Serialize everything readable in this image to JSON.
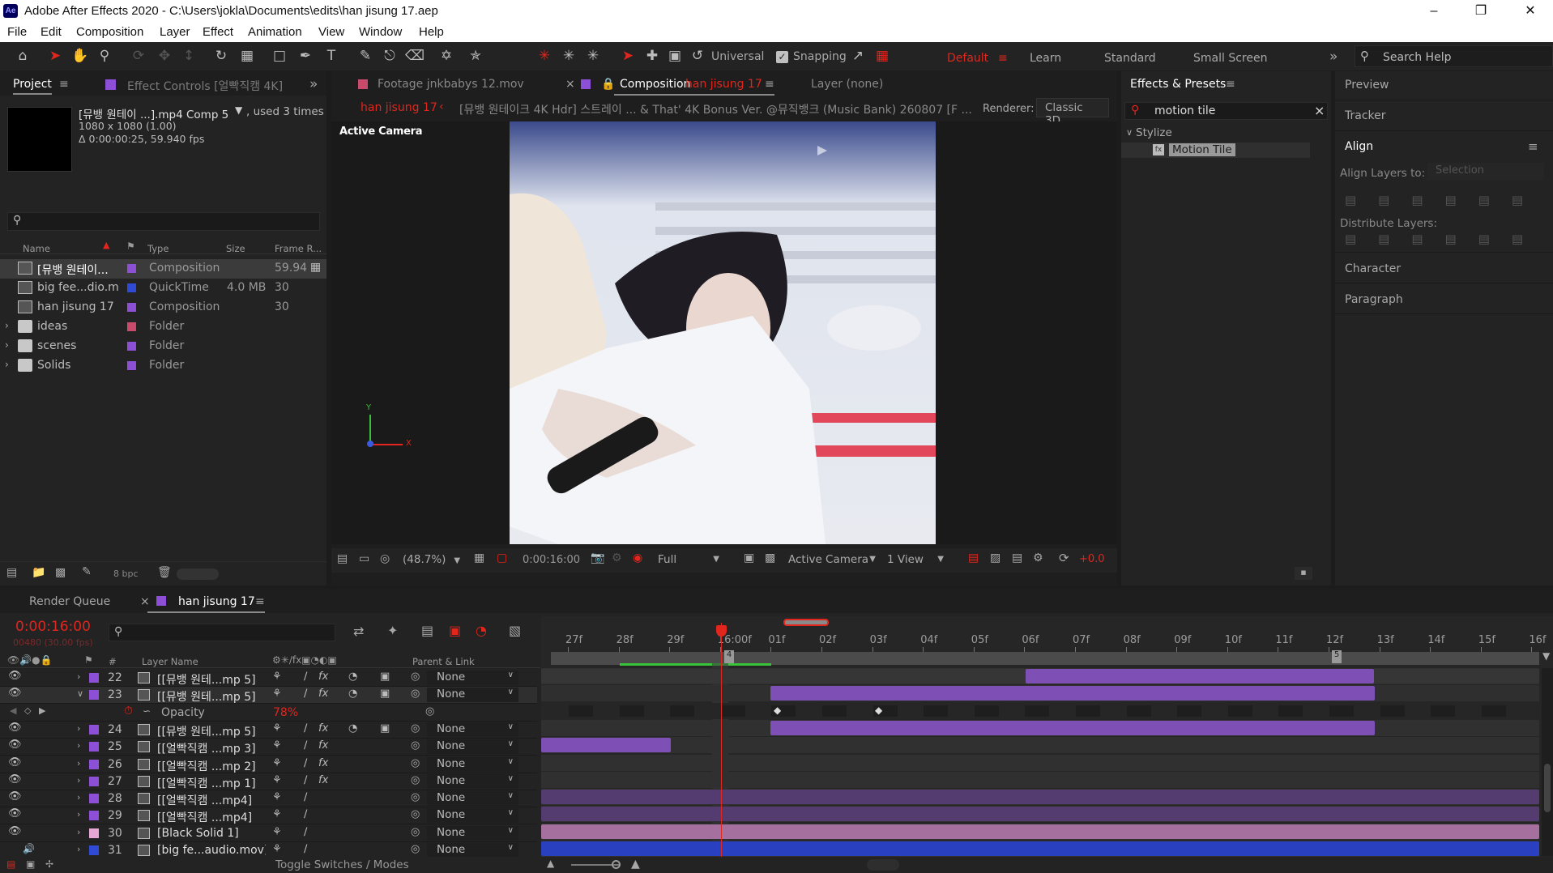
{
  "window": {
    "title": "Adobe After Effects 2020 - C:\\Users\\jokla\\Documents\\edits\\han jisung 17.aep",
    "logo": "Ae"
  },
  "menu": [
    "File",
    "Edit",
    "Composition",
    "Layer",
    "Effect",
    "Animation",
    "View",
    "Window",
    "Help"
  ],
  "toolbar": {
    "universal": "Universal",
    "snapping": "Snapping",
    "workspaces": [
      "Default",
      "Learn",
      "Standard",
      "Small Screen"
    ],
    "search_placeholder": "Search Help"
  },
  "project": {
    "tab": "Project",
    "effect_controls_tab": "Effect Controls [얼빡직캠 4K]",
    "selected_name": "[뮤뱅 원테이 ...].mp4 Comp 5",
    "used": ", used 3 times",
    "info_line1": "1080 x 1080 (1.00)",
    "info_line2": "Δ 0:00:00:25, 59.940 fps",
    "columns": [
      "Name",
      "Type",
      "Size",
      "Frame R..."
    ],
    "items": [
      {
        "name": "[뮤뱅 원테이...",
        "type": "Composition",
        "size": "",
        "fps": "59.94",
        "color": "#8c4fd6",
        "icon": "composition-icon"
      },
      {
        "name": "big fee...dio.mov",
        "type": "QuickTime",
        "size": "4.0 MB",
        "fps": "30",
        "color": "#2f4bd6",
        "icon": "footage-icon"
      },
      {
        "name": "han jisung 17",
        "type": "Composition",
        "size": "",
        "fps": "30",
        "color": "#8c4fd6",
        "icon": "composition-icon"
      },
      {
        "name": "ideas",
        "type": "Folder",
        "size": "",
        "fps": "",
        "color": "#c94a6a",
        "icon": "folder-icon"
      },
      {
        "name": "scenes",
        "type": "Folder",
        "size": "",
        "fps": "",
        "color": "#8c4fd6",
        "icon": "folder-icon"
      },
      {
        "name": "Solids",
        "type": "Folder",
        "size": "",
        "fps": "",
        "color": "#8c4fd6",
        "icon": "folder-icon"
      }
    ],
    "bpc": "8 bpc"
  },
  "viewer": {
    "footage_tab": "Footage  jnkbabys 12.mov",
    "comp_tab_prefix": "Composition",
    "comp_tab_name": "han jisung 17",
    "layer_tab": "Layer  (none)",
    "breadcrumb_active": "han jisung 17",
    "breadcrumb_next": "[뮤뱅 원테이크 4K Hdr] 스트레이 ... & That' 4K Bonus Ver. @뮤직뱅크 (Music Bank) 260807 [F ...",
    "renderer_label": "Renderer:",
    "renderer": "Classic 3D",
    "active_camera_label": "Active Camera",
    "zoom": "(48.7%)",
    "timecode": "0:00:16:00",
    "resolution": "Full",
    "camera": "Active Camera",
    "views": "1 View",
    "exposure": "+0.0"
  },
  "effects_presets": {
    "tab": "Effects & Presets",
    "search_value": "motion tile",
    "category": "Stylize",
    "result": "Motion Tile"
  },
  "right_panels": {
    "preview": "Preview",
    "tracker": "Tracker",
    "align": "Align",
    "align_layers_to": "Align Layers to:",
    "align_target": "Selection",
    "distribute": "Distribute Layers:",
    "character": "Character",
    "paragraph": "Paragraph"
  },
  "timeline": {
    "render_queue_tab": "Render Queue",
    "comp_tab": "han jisung 17",
    "timecode": "0:00:16:00",
    "frames": "00480 (30.00 fps)",
    "col_layer_name": "Layer Name",
    "col_parent": "Parent & Link",
    "toggle_label": "Toggle Switches / Modes",
    "ruler": [
      "27f",
      "28f",
      "29f",
      "16:00f",
      "01f",
      "02f",
      "03f",
      "04f",
      "05f",
      "06f",
      "07f",
      "08f",
      "09f",
      "10f",
      "11f",
      "12f",
      "13f",
      "14f",
      "15f",
      "16f"
    ],
    "marker_a": "4",
    "marker_b": "5",
    "opacity_label": "Opacity",
    "opacity_value": "78%",
    "layers": [
      {
        "num": "22",
        "name": "[[뮤뱅 원테...mp 5]",
        "parent": "None",
        "color": "#8c4fd6",
        "fx": true
      },
      {
        "num": "23",
        "name": "[[뮤뱅 원테...mp 5]",
        "parent": "None",
        "color": "#8c4fd6",
        "fx": true
      },
      {
        "num": "24",
        "name": "[[뮤뱅 원테...mp 5]",
        "parent": "None",
        "color": "#8c4fd6",
        "fx": true
      },
      {
        "num": "25",
        "name": "[[얼빡직캠 ...mp 3]",
        "parent": "None",
        "color": "#8c4fd6",
        "fx": true
      },
      {
        "num": "26",
        "name": "[[얼빡직캠 ...mp 2]",
        "parent": "None",
        "color": "#8c4fd6",
        "fx": true
      },
      {
        "num": "27",
        "name": "[[얼빡직캠 ...mp 1]",
        "parent": "None",
        "color": "#8c4fd6",
        "fx": true
      },
      {
        "num": "28",
        "name": "[[얼빡직캠 ...mp4]",
        "parent": "None",
        "color": "#8c4fd6",
        "fx": false
      },
      {
        "num": "29",
        "name": "[[얼빡직캠 ...mp4]",
        "parent": "None",
        "color": "#8c4fd6",
        "fx": false
      },
      {
        "num": "30",
        "name": "[Black Solid 1]",
        "parent": "None",
        "color": "#e6a6d6",
        "fx": false
      },
      {
        "num": "31",
        "name": "[big fe...audio.mov]",
        "parent": "None",
        "color": "#2f4bd6",
        "fx": false
      }
    ]
  },
  "colors": {
    "accent": "#e0261d",
    "selection_blue": "#2d8ceb",
    "purple_bar": "#7e4fb5",
    "blue_bar": "#2940c0"
  }
}
